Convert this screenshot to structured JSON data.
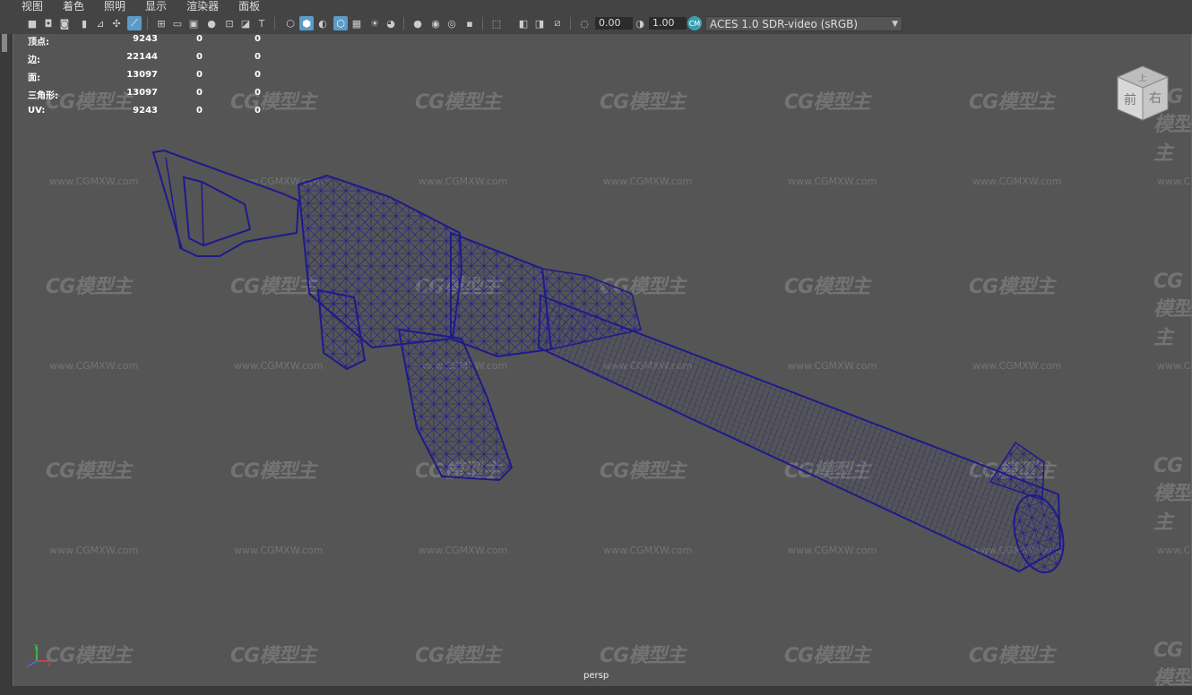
{
  "menu": {
    "items": [
      "视图",
      "着色",
      "照明",
      "显示",
      "渲染器",
      "面板"
    ]
  },
  "toolbar": {
    "exposure_value": "0.00",
    "gamma_value": "1.00",
    "color_space": "ACES 1.0 SDR-video (sRGB)"
  },
  "hud": {
    "rows": [
      {
        "label": "顶点:",
        "v1": "9243",
        "v2": "0",
        "v3": "0"
      },
      {
        "label": "边:",
        "v1": "22144",
        "v2": "0",
        "v3": "0"
      },
      {
        "label": "面:",
        "v1": "13097",
        "v2": "0",
        "v3": "0"
      },
      {
        "label": "三角形:",
        "v1": "13097",
        "v2": "0",
        "v3": "0"
      },
      {
        "label": "UV:",
        "v1": "9243",
        "v2": "0",
        "v3": "0"
      }
    ]
  },
  "view_cube": {
    "top": "上",
    "front": "前",
    "right": "右"
  },
  "viewport": {
    "camera_label": "persp",
    "background_color": "#555555",
    "wireframe_color": "#1e1a8c"
  },
  "watermark": {
    "logo_text": "CG模型主",
    "url_text": "www.CGMXW.com"
  },
  "axis": {
    "x": "x",
    "y": "y",
    "z": "z"
  }
}
